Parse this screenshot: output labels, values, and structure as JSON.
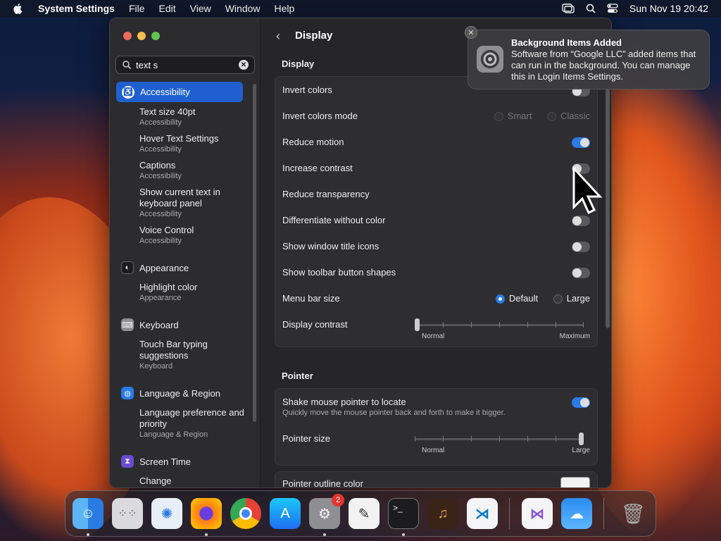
{
  "menubar": {
    "app": "System Settings",
    "items": [
      "File",
      "Edit",
      "View",
      "Window",
      "Help"
    ],
    "datetime": "Sun Nov 19  20:42"
  },
  "sidebar": {
    "search_value": "text s",
    "selected": "Accessibility",
    "results": [
      {
        "title": "Text size 40pt",
        "sub": "Accessibility"
      },
      {
        "title": "Hover Text Settings",
        "sub": "Accessibility"
      },
      {
        "title": "Captions",
        "sub": "Accessibility"
      },
      {
        "title": "Show current text in keyboard panel",
        "sub": "Accessibility"
      },
      {
        "title": "Voice Control",
        "sub": "Accessibility"
      }
    ],
    "appearance": "Appearance",
    "appearance_results": [
      {
        "title": "Highlight color",
        "sub": "Appearance"
      }
    ],
    "keyboard": "Keyboard",
    "keyboard_results": [
      {
        "title": "Touch Bar typing suggestions",
        "sub": "Keyboard"
      }
    ],
    "language": "Language & Region",
    "language_results": [
      {
        "title": "Language preference and priority",
        "sub": "Language & Region"
      }
    ],
    "screentime": "Screen Time",
    "screentime_results": [
      {
        "title": "Change",
        "sub": ""
      }
    ]
  },
  "main": {
    "title": "Display",
    "display_section": "Display",
    "rows": {
      "invert_colors": "Invert colors",
      "invert_mode": "Invert colors mode",
      "invert_mode_opt1": "Smart",
      "invert_mode_opt2": "Classic",
      "reduce_motion": "Reduce motion",
      "increase_contrast": "Increase contrast",
      "reduce_transparency": "Reduce transparency",
      "differentiate": "Differentiate without color",
      "window_title_icons": "Show window title icons",
      "toolbar_shapes": "Show toolbar button shapes",
      "menu_bar_size": "Menu bar size",
      "menu_bar_opt1": "Default",
      "menu_bar_opt2": "Large",
      "display_contrast": "Display contrast",
      "contrast_min": "Normal",
      "contrast_max": "Maximum"
    },
    "toggles": {
      "reduce_motion": true,
      "increase_contrast": false,
      "differentiate": false,
      "window_title_icons": false,
      "toolbar_shapes": false,
      "shake": true
    },
    "pointer_section": "Pointer",
    "pointer": {
      "shake": "Shake mouse pointer to locate",
      "shake_desc": "Quickly move the mouse pointer back and forth to make it bigger.",
      "size": "Pointer size",
      "size_min": "Normal",
      "size_max": "Large",
      "outline": "Pointer outline color"
    },
    "contrast_level": 0.0,
    "pointer_size_level": 1.0
  },
  "notification": {
    "title": "Background Items Added",
    "body": "Software from “Google LLC” added items that can run in the background. You can manage this in Login Items Settings."
  },
  "dock": {
    "apps": [
      "finder-icon",
      "launchpad-icon",
      "safari-icon",
      "firefox-icon",
      "chrome-icon",
      "app-store-icon",
      "system-settings-icon",
      "textedit-icon",
      "terminal-icon",
      "garageband-icon",
      "vscode-icon",
      "visual-studio-icon",
      "weather-icon",
      "trash-icon"
    ],
    "settings_badge": "2"
  },
  "colors": {
    "accent": "#2a7be4",
    "selection": "#1f5fcf"
  }
}
